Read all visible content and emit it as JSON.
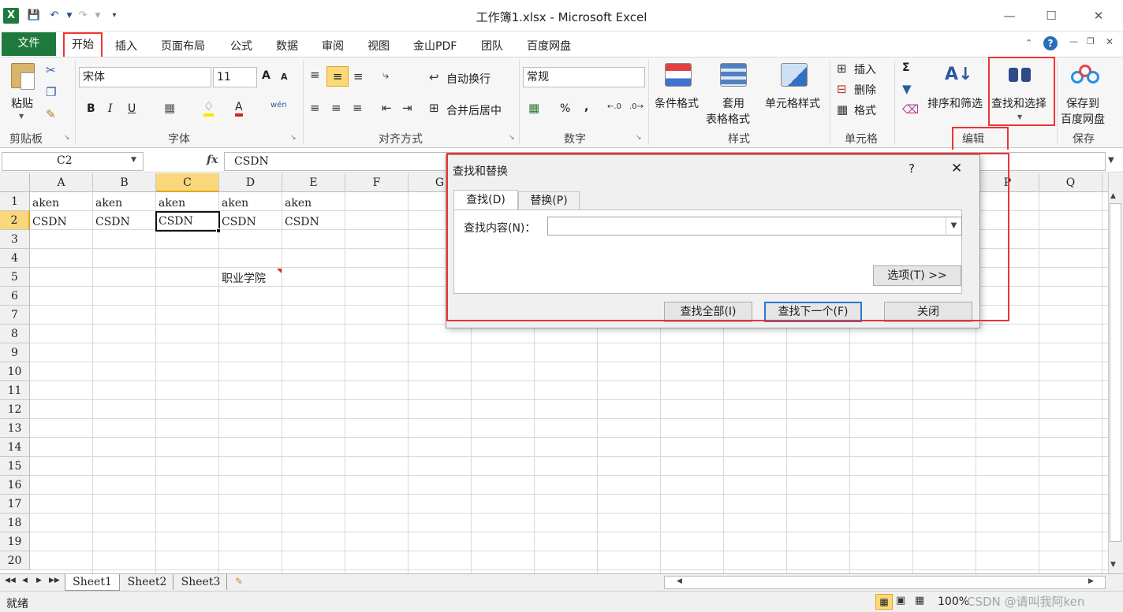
{
  "window": {
    "title": "工作簿1.xlsx - Microsoft Excel",
    "minimize": "—",
    "maximize": "☐",
    "close": "✕"
  },
  "menu": {
    "file": "文件",
    "items": [
      "开始",
      "插入",
      "页面布局",
      "公式",
      "数据",
      "审阅",
      "视图",
      "金山PDF",
      "团队",
      "百度网盘"
    ]
  },
  "ribbon": {
    "clipboard": {
      "paste": "粘贴",
      "label": "剪贴板"
    },
    "font": {
      "name": "宋体",
      "size": "11",
      "label": "字体",
      "bold": "B",
      "italic": "I",
      "underline": "U",
      "grow": "A",
      "shrink": "A",
      "color": "A",
      "wen": "wén"
    },
    "alignment": {
      "wrap": "自动换行",
      "merge": "合并后居中",
      "label": "对齐方式"
    },
    "number": {
      "format": "常规",
      "percent": "%",
      "comma": ",",
      "label": "数字"
    },
    "styles": {
      "conditional": "条件格式",
      "table1": "套用",
      "table2": "表格格式",
      "cell_style": "单元格样式",
      "label": "样式"
    },
    "cells": {
      "insert": "插入",
      "delete": "删除",
      "format": "格式",
      "label": "单元格"
    },
    "editing": {
      "sigma": "Σ",
      "sort_filter": "排序和筛选",
      "find_select": "查找和选择",
      "label": "编辑"
    },
    "save": {
      "line1": "保存到",
      "line2": "百度网盘",
      "label": "保存"
    }
  },
  "formula_bar": {
    "name_box": "C2",
    "fx": "fx",
    "content": "CSDN"
  },
  "columns": [
    "A",
    "B",
    "C",
    "D",
    "E",
    "F",
    "G",
    "P",
    "Q"
  ],
  "rows": [
    "1",
    "2",
    "3",
    "4",
    "5",
    "6",
    "7",
    "8",
    "9",
    "10",
    "11",
    "12",
    "13",
    "14",
    "15",
    "16",
    "17",
    "18",
    "19",
    "20"
  ],
  "cells": {
    "A1": "aken",
    "B1": "aken",
    "C1": "aken",
    "D1": "aken",
    "E1": "aken",
    "A2": "CSDN",
    "B2": "CSDN",
    "C2": "CSDN",
    "D2": "CSDN",
    "E2": "CSDN",
    "D5": "职业学院"
  },
  "dialog": {
    "title": "查找和替换",
    "help": "?",
    "close": "✕",
    "tab_find": "查找(D)",
    "tab_replace": "替换(P)",
    "find_label": "查找内容(N)：",
    "find_value": "",
    "options": "选项(T) >>",
    "find_all": "查找全部(I)",
    "find_next": "查找下一个(F)",
    "close_btn": "关闭"
  },
  "sheets": [
    "Sheet1",
    "Sheet2",
    "Sheet3"
  ],
  "status": {
    "ready": "就绪",
    "zoom": "100%",
    "watermark": "CSDN @请叫我阿ken"
  },
  "colors": {
    "file_tab": "#1e7a3c",
    "highlight": "#e33",
    "selected_header": "#f8d77d"
  }
}
